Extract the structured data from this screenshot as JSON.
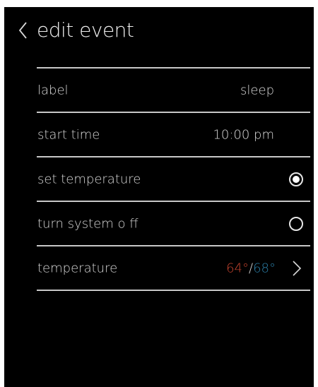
{
  "header": {
    "title": "edit event"
  },
  "rows": [
    {
      "label": "label",
      "value": "sleep"
    },
    {
      "label": "start time",
      "value": "10:00 pm"
    },
    {
      "label": "set temperature",
      "selected": true
    },
    {
      "label": "turn system o ff",
      "selected": false
    },
    {
      "label": "temperature",
      "heat": "64°",
      "separator": "/",
      "cool": "68°"
    }
  ],
  "colors": {
    "background": "#000000",
    "heat": "#c7442f",
    "cool": "#2b7fa8",
    "text": "#d8d8d8"
  },
  "icons": {
    "back": "chevron-left-icon",
    "next": "chevron-right-icon"
  }
}
